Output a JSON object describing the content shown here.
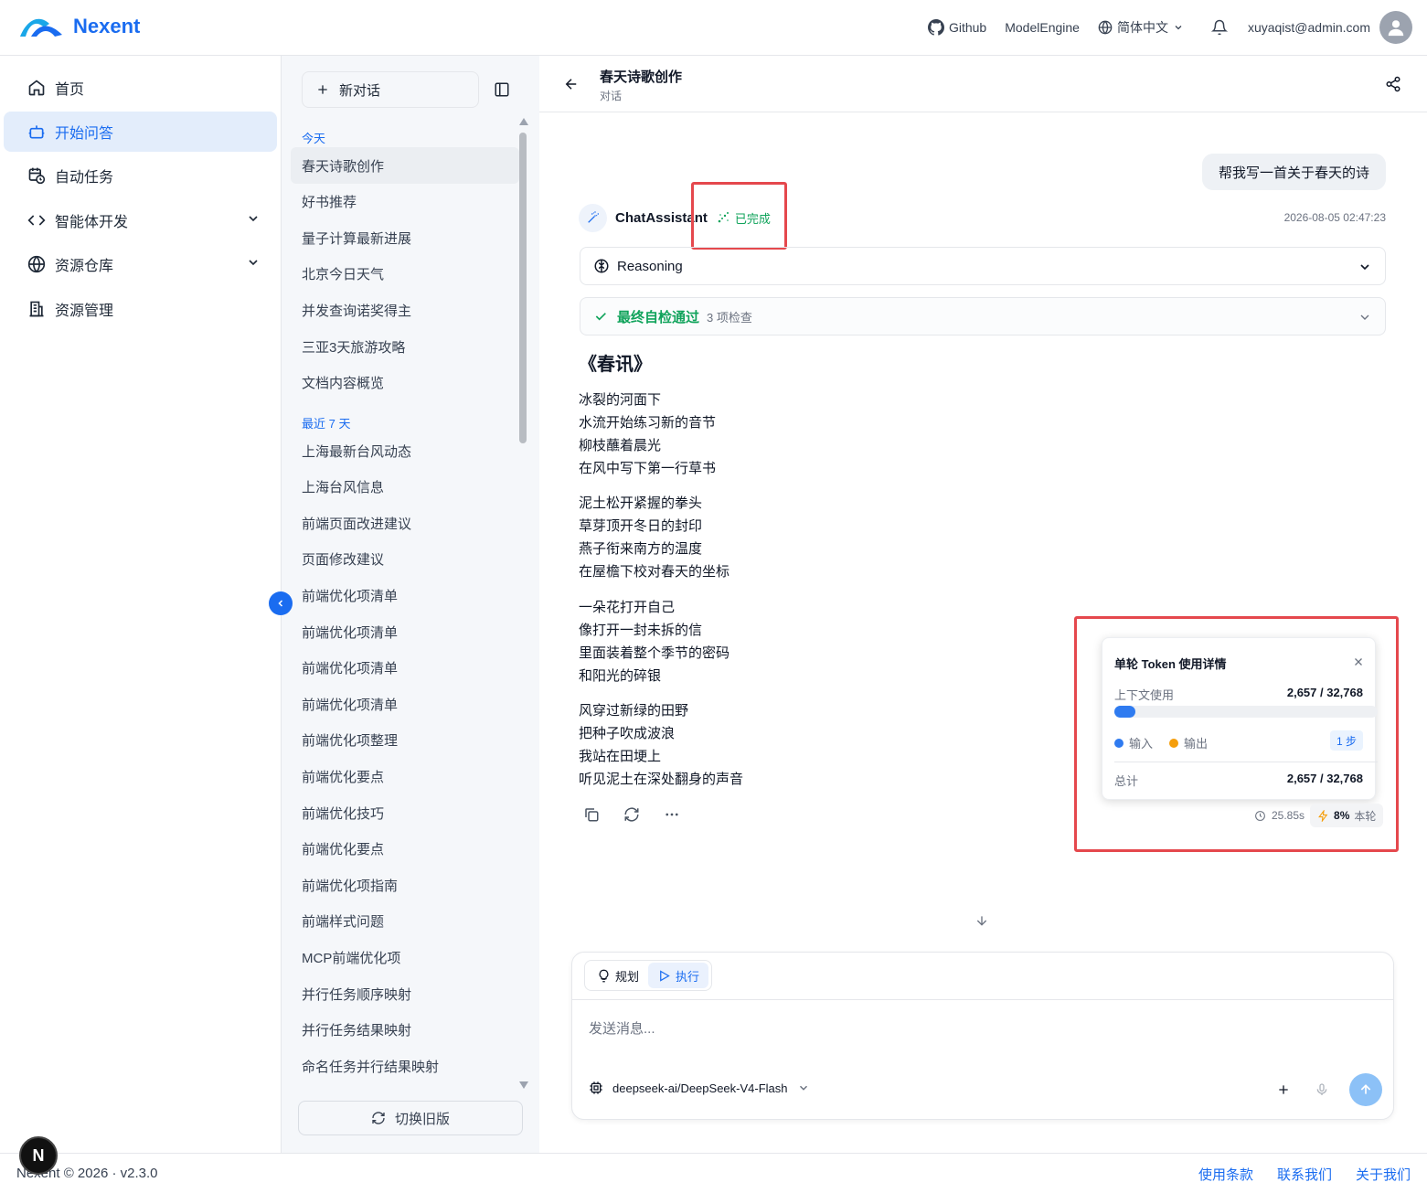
{
  "app": {
    "name": "Nexent"
  },
  "topbar": {
    "github": "Github",
    "modelengine": "ModelEngine",
    "language": "简体中文",
    "user_email": "xuyaqist@admin.com"
  },
  "sidebar": {
    "items": [
      {
        "label": "首页",
        "icon": "home-icon"
      },
      {
        "label": "开始问答",
        "icon": "bot-icon",
        "active": true
      },
      {
        "label": "自动任务",
        "icon": "calendar-clock-icon"
      },
      {
        "label": "智能体开发",
        "icon": "code-icon",
        "expandable": true
      },
      {
        "label": "资源仓库",
        "icon": "globe-icon",
        "expandable": true
      },
      {
        "label": "资源管理",
        "icon": "building-icon"
      }
    ]
  },
  "conversations": {
    "new_chat": "新对话",
    "today_label": "今天",
    "today": [
      "春天诗歌创作",
      "好书推荐",
      "量子计算最新进展",
      "北京今日天气",
      "并发查询诺奖得主",
      "三亚3天旅游攻略",
      "文档内容概览"
    ],
    "week_label": "最近 7 天",
    "week": [
      "上海最新台风动态",
      "上海台风信息",
      "前端页面改进建议",
      "页面修改建议",
      "前端优化项清单",
      "前端优化项清单",
      "前端优化项清单",
      "前端优化项清单",
      "前端优化项整理",
      "前端优化要点",
      "前端优化技巧",
      "前端优化要点",
      "前端优化项指南",
      "前端样式问题",
      "MCP前端优化项",
      "并行任务顺序映射",
      "并行任务结果映射",
      "命名任务并行结果映射"
    ],
    "switch_label": "切换旧版"
  },
  "chat": {
    "title": "春天诗歌创作",
    "subtitle": "对话",
    "user_message": "帮我写一首关于春天的诗",
    "agent_name": "ChatAssistant",
    "status": "已完成",
    "timestamp": "2026-08-05 02:47:23",
    "reasoning_label": "Reasoning",
    "check_label": "最终自检通过",
    "check_count": "3 项检查",
    "poem_title": "《春讯》",
    "stanzas": [
      [
        "冰裂的河面下",
        "水流开始练习新的音节",
        "柳枝蘸着晨光",
        "在风中写下第一行草书"
      ],
      [
        "泥土松开紧握的拳头",
        "草芽顶开冬日的封印",
        "燕子衔来南方的温度",
        "在屋檐下校对春天的坐标"
      ],
      [
        "一朵花打开自己",
        "像打开一封未拆的信",
        "里面装着整个季节的密码",
        "和阳光的碎银"
      ],
      [
        "风穿过新绿的田野",
        "把种子吹成波浪",
        "我站在田埂上",
        "听见泥土在深处翻身的声音"
      ]
    ]
  },
  "token": {
    "title": "单轮 Token 使用详情",
    "context_label": "上下文使用",
    "context_value": "2,657 / 32,768",
    "context_used": 2657,
    "context_max": 32768,
    "input_label": "输入",
    "output_label": "输出",
    "steps": "1 步",
    "total_label": "总计",
    "total_value": "2,657 / 32,768",
    "duration": "25.85s",
    "percent": "8%",
    "round_label": "本轮",
    "input_color": "#2f7bf0",
    "output_color": "#f59e0b"
  },
  "input": {
    "mode_plan": "规划",
    "mode_execute": "执行",
    "placeholder": "发送消息...",
    "model": "deepseek-ai/DeepSeek-V4-Flash"
  },
  "footer": {
    "copyright": "Nexent © 2026 · v2.3.0",
    "terms": "使用条款",
    "contact": "联系我们",
    "about": "关于我们"
  },
  "colors": {
    "accent": "#1a6cf0",
    "success": "#10a35b",
    "highlight": "#e5484d"
  }
}
